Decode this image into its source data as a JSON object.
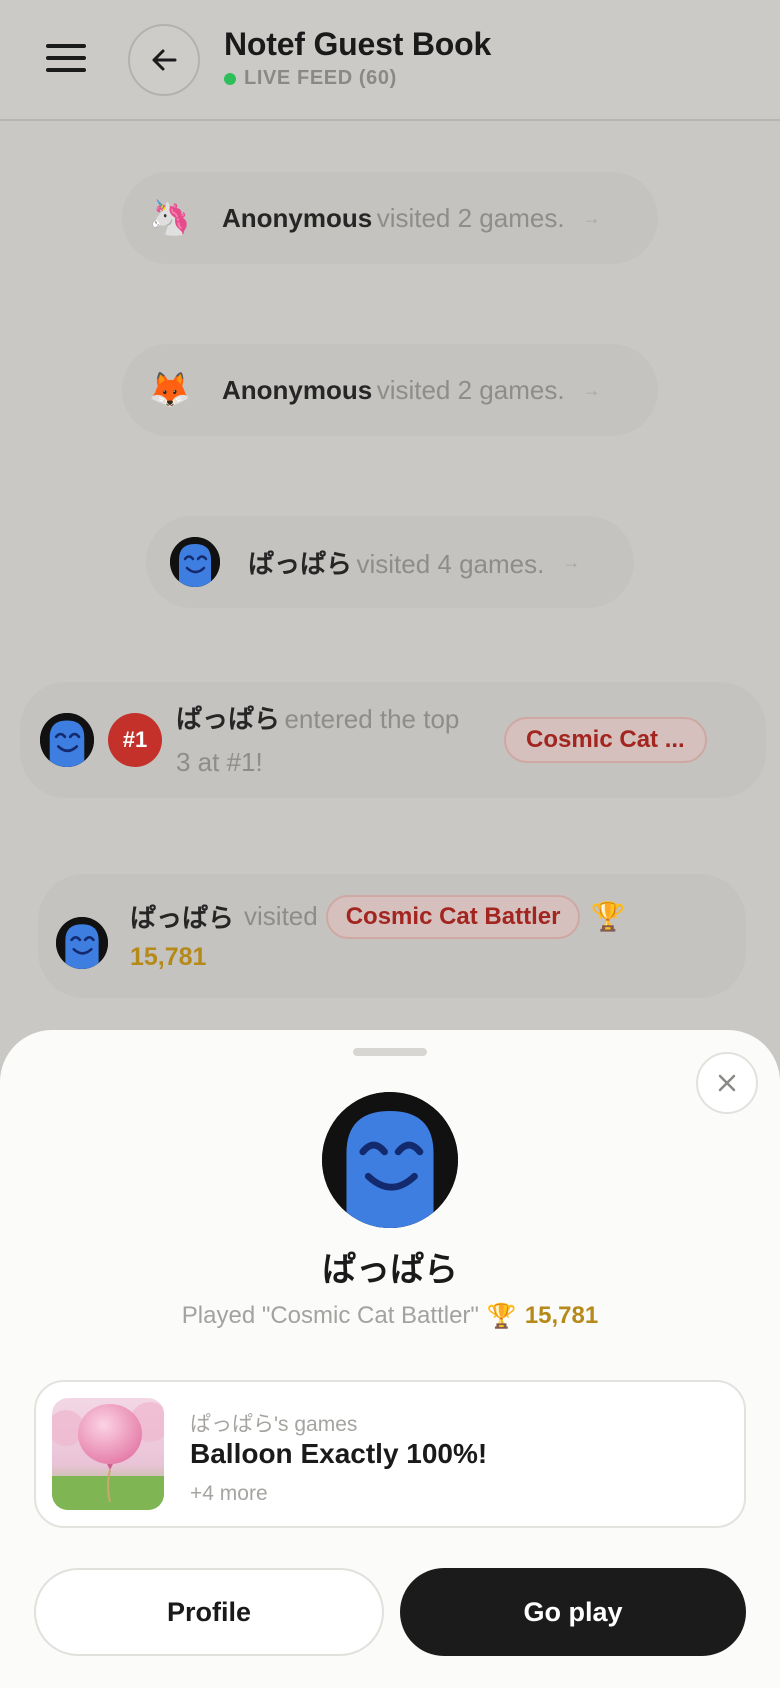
{
  "header": {
    "title": "Notef Guest Book",
    "live_label": "LIVE FEED (60)"
  },
  "feed": [
    {
      "avatar_icon": "unicorn-icon",
      "avatar_glyph": "🦄",
      "name": "Anonymous",
      "text": "visited 2 games."
    },
    {
      "avatar_icon": "fox-icon",
      "avatar_glyph": "🦊",
      "name": "Anonymous",
      "text": "visited 2 games."
    },
    {
      "avatar_icon": "face-avatar",
      "name": "ぱっぱら",
      "text": "visited 4 games."
    },
    {
      "avatar_icon": "face-avatar",
      "badge": "#1",
      "name": "ぱっぱら",
      "text_line1": "entered the top",
      "text_line2": "3 at #1!",
      "game": "Cosmic Cat ..."
    },
    {
      "avatar_icon": "face-avatar",
      "name": "ぱっぱら",
      "text": "visited",
      "game": "Cosmic Cat Battler",
      "score": "15,781"
    }
  ],
  "sheet": {
    "name": "ぱっぱら",
    "played_text": "Played \"Cosmic Cat Battler\"",
    "score": "15,781",
    "card": {
      "owner": "ぱっぱら's games",
      "title": "Balloon Exactly 100%!",
      "more": "+4 more"
    },
    "profile_label": "Profile",
    "play_label": "Go play"
  },
  "colors": {
    "accent_red": "#c4302a",
    "score_gold": "#b58a1a",
    "live_green": "#2fbf5a",
    "primary_button": "#1b1b1b"
  }
}
